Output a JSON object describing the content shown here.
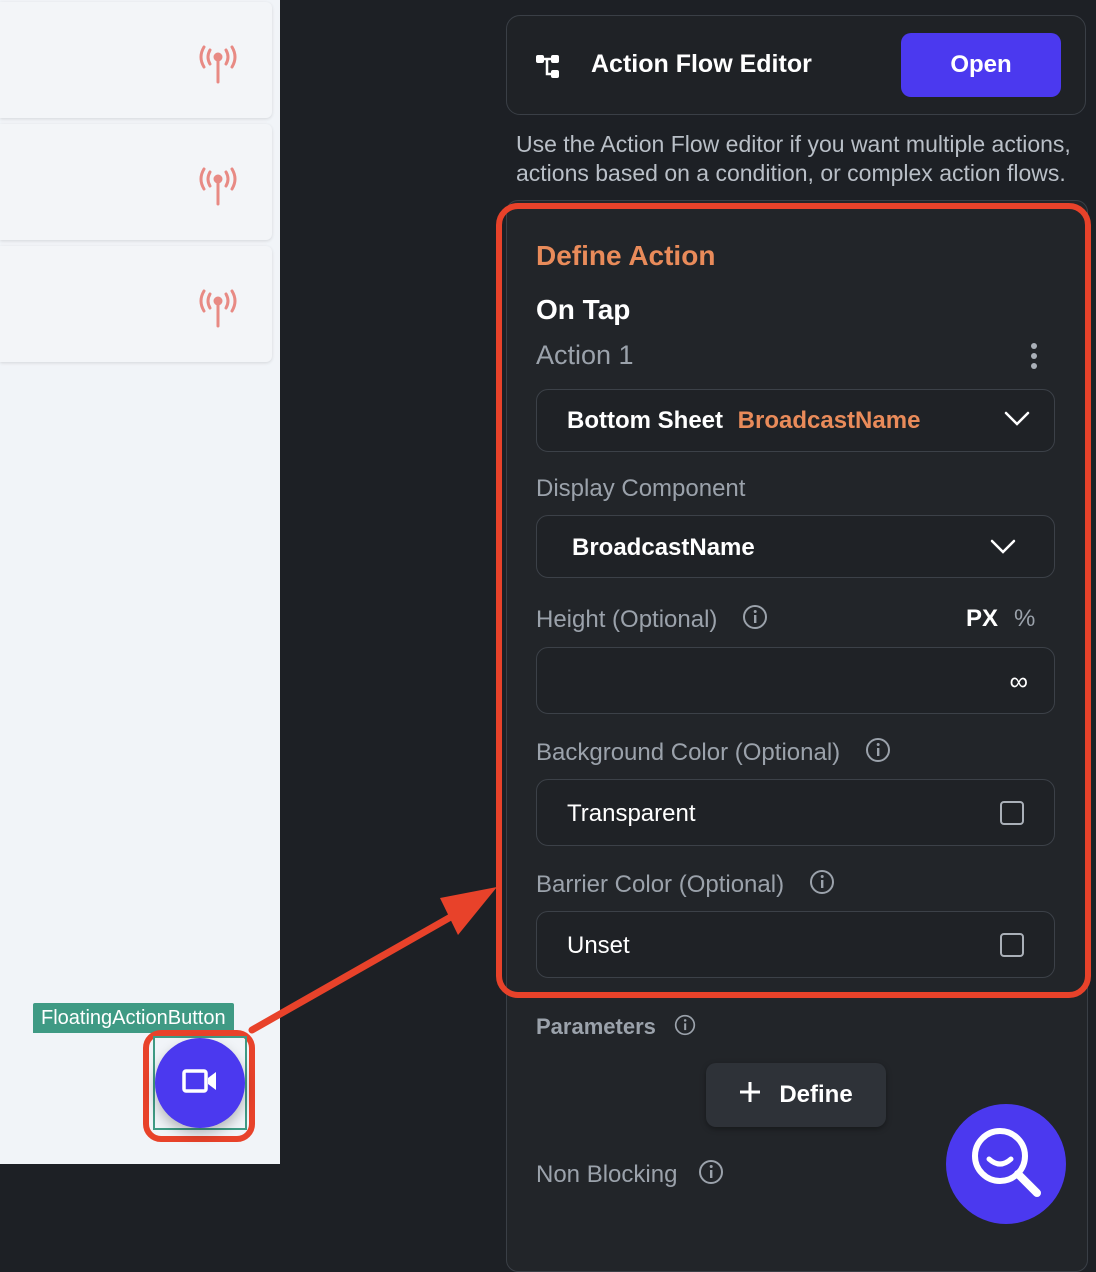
{
  "canvas": {
    "cards": [
      {
        "icon": "broadcast-icon"
      },
      {
        "icon": "broadcast-icon"
      },
      {
        "icon": "broadcast-icon"
      }
    ],
    "fab_label": "FloatingActionButton",
    "fab_icon": "videocam-icon"
  },
  "action_flow": {
    "icon": "flow-tree-icon",
    "title": "Action Flow Editor",
    "open_label": "Open",
    "description": "Use the Action Flow editor if you want multiple actions, actions based on a condition, or complex action flows."
  },
  "define_action": {
    "heading": "Define Action",
    "trigger": "On Tap",
    "action_label": "Action 1",
    "action_type": "Bottom Sheet",
    "action_target": "BroadcastName",
    "display_component_label": "Display Component",
    "display_component_value": "BroadcastName",
    "height_label": "Height (Optional)",
    "unit_px": "PX",
    "unit_percent": "%",
    "height_placeholder_symbol": "∞",
    "background_color_label": "Background Color (Optional)",
    "background_color_value": "Transparent",
    "barrier_color_label": "Barrier Color (Optional)",
    "barrier_color_value": "Unset"
  },
  "parameters": {
    "label": "Parameters",
    "define_label": "Define"
  },
  "non_blocking": {
    "label": "Non Blocking"
  },
  "colors": {
    "accent": "#4b39ef",
    "highlight": "#e8422a",
    "heading": "#e98b5a",
    "panel_bg": "#1d2025"
  }
}
